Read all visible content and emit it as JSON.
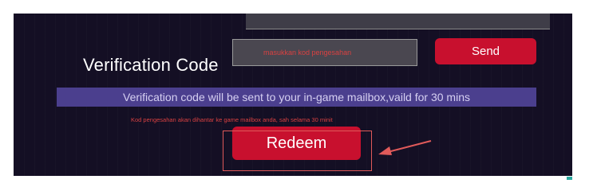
{
  "form": {
    "verification_label": "Verification Code",
    "code_placeholder": "masukkan kod pengesahan",
    "send_label": "Send",
    "notice": "Verification code will be sent to your in-game mailbox,vaild for 30 mins",
    "hint": "Kod pengesahan akan dihantar ke game mailbox anda, sah selama 30 minit",
    "redeem_label": "Redeem"
  },
  "colors": {
    "panel_bg": "#140f24",
    "button": "#c8102e",
    "notice_bar": "#4b3f8e",
    "hint_text": "#d94141",
    "annotation": "#e05a5a"
  },
  "icons": {
    "annotation": "arrow-pointer-icon"
  }
}
